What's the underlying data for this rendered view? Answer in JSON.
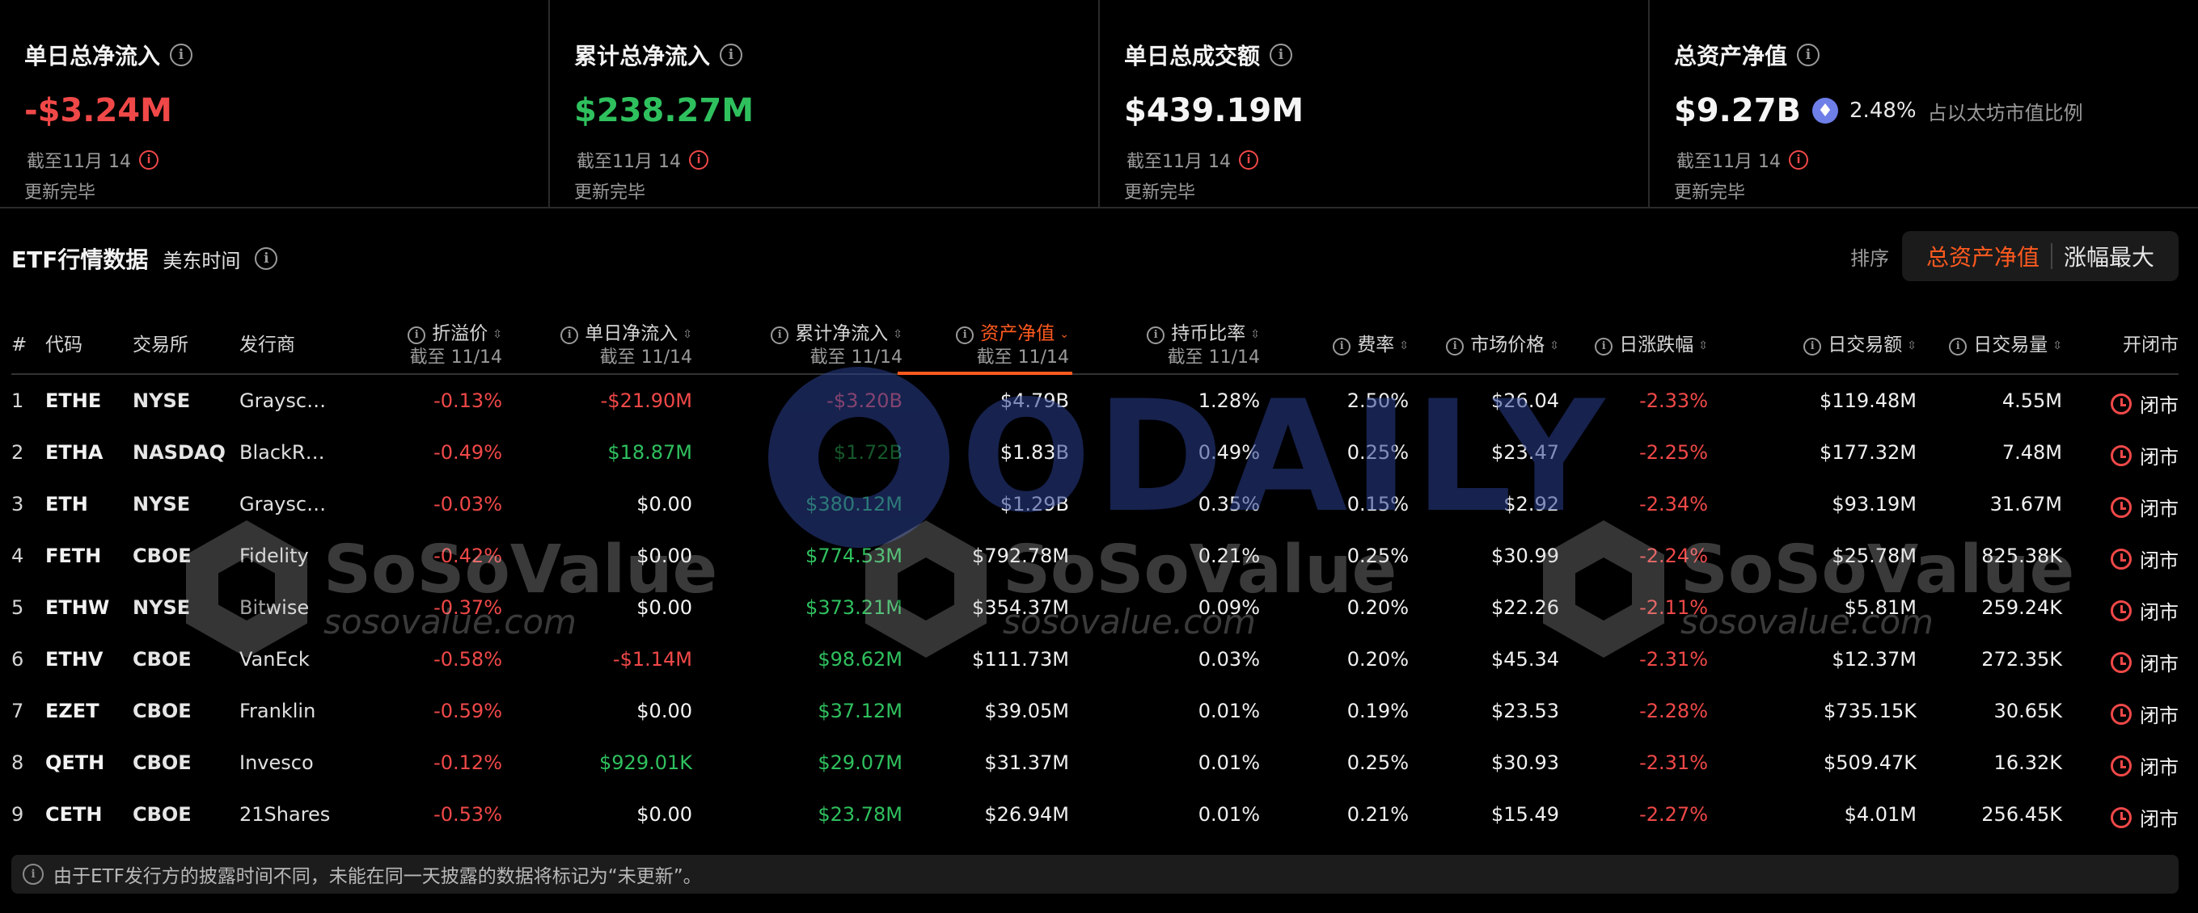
{
  "stats": [
    {
      "label": "单日总净流入",
      "value": "-$3.24M",
      "value_color": "red",
      "asof": "截至11月 14",
      "update": "更新完毕"
    },
    {
      "label": "累计总净流入",
      "value": "$238.27M",
      "value_color": "green",
      "asof": "截至11月 14",
      "update": "更新完毕"
    },
    {
      "label": "单日总成交额",
      "value": "$439.19M",
      "value_color": "white",
      "asof": "截至11月 14",
      "update": "更新完毕"
    },
    {
      "label": "总资产净值",
      "value": "$9.27B",
      "value_color": "white",
      "pct": "2.48%",
      "pct_label": "占以太坊市值比例",
      "asof": "截至11月 14",
      "update": "更新完毕"
    }
  ],
  "section": {
    "title": "ETF行情数据",
    "timezone": "美东时间",
    "sort_label": "排序",
    "sort_options": [
      "总资产净值",
      "涨幅最大"
    ]
  },
  "columns": {
    "num": "#",
    "code": "代码",
    "exchange": "交易所",
    "issuer": "发行商",
    "premium": "折溢价",
    "daily_net": "单日净流入",
    "cum_net": "累计净流入",
    "nav": "资产净值",
    "holding": "持币比率",
    "fee": "费率",
    "price": "市场价格",
    "change": "日涨跌幅",
    "volume": "日交易额",
    "qty": "日交易量",
    "openclose": "开闭市",
    "asof_sub": "截至 11/14"
  },
  "rows": [
    {
      "num": "1",
      "code": "ETHE",
      "exchange": "NYSE",
      "issuer": "Graysc…",
      "premium": "-0.13%",
      "daily_net": "-$21.90M",
      "daily_net_color": "red",
      "cum_net": "-$3.20B",
      "cum_net_color": "red",
      "nav": "$4.79B",
      "holding": "1.28%",
      "fee": "2.50%",
      "price": "$26.04",
      "change": "-2.33%",
      "volume": "$119.48M",
      "qty": "4.55M",
      "status": "闭市"
    },
    {
      "num": "2",
      "code": "ETHA",
      "exchange": "NASDAQ",
      "issuer": "BlackR…",
      "premium": "-0.49%",
      "daily_net": "$18.87M",
      "daily_net_color": "green",
      "cum_net": "$1.72B",
      "cum_net_color": "green",
      "nav": "$1.83B",
      "holding": "0.49%",
      "fee": "0.25%",
      "price": "$23.47",
      "change": "-2.25%",
      "volume": "$177.32M",
      "qty": "7.48M",
      "status": "闭市"
    },
    {
      "num": "3",
      "code": "ETH",
      "exchange": "NYSE",
      "issuer": "Graysc…",
      "premium": "-0.03%",
      "daily_net": "$0.00",
      "daily_net_color": "white",
      "cum_net": "$380.12M",
      "cum_net_color": "green",
      "nav": "$1.29B",
      "holding": "0.35%",
      "fee": "0.15%",
      "price": "$2.92",
      "change": "-2.34%",
      "volume": "$93.19M",
      "qty": "31.67M",
      "status": "闭市"
    },
    {
      "num": "4",
      "code": "FETH",
      "exchange": "CBOE",
      "issuer": "Fidelity",
      "premium": "-0.42%",
      "daily_net": "$0.00",
      "daily_net_color": "white",
      "cum_net": "$774.53M",
      "cum_net_color": "green",
      "nav": "$792.78M",
      "holding": "0.21%",
      "fee": "0.25%",
      "price": "$30.99",
      "change": "-2.24%",
      "volume": "$25.78M",
      "qty": "825.38K",
      "status": "闭市"
    },
    {
      "num": "5",
      "code": "ETHW",
      "exchange": "NYSE",
      "issuer": "Bitwise",
      "premium": "-0.37%",
      "daily_net": "$0.00",
      "daily_net_color": "white",
      "cum_net": "$373.21M",
      "cum_net_color": "green",
      "nav": "$354.37M",
      "holding": "0.09%",
      "fee": "0.20%",
      "price": "$22.26",
      "change": "-2.11%",
      "volume": "$5.81M",
      "qty": "259.24K",
      "status": "闭市"
    },
    {
      "num": "6",
      "code": "ETHV",
      "exchange": "CBOE",
      "issuer": "VanEck",
      "premium": "-0.58%",
      "daily_net": "-$1.14M",
      "daily_net_color": "red",
      "cum_net": "$98.62M",
      "cum_net_color": "green",
      "nav": "$111.73M",
      "holding": "0.03%",
      "fee": "0.20%",
      "price": "$45.34",
      "change": "-2.31%",
      "volume": "$12.37M",
      "qty": "272.35K",
      "status": "闭市"
    },
    {
      "num": "7",
      "code": "EZET",
      "exchange": "CBOE",
      "issuer": "Franklin",
      "premium": "-0.59%",
      "daily_net": "$0.00",
      "daily_net_color": "white",
      "cum_net": "$37.12M",
      "cum_net_color": "green",
      "nav": "$39.05M",
      "holding": "0.01%",
      "fee": "0.19%",
      "price": "$23.53",
      "change": "-2.28%",
      "volume": "$735.15K",
      "qty": "30.65K",
      "status": "闭市"
    },
    {
      "num": "8",
      "code": "QETH",
      "exchange": "CBOE",
      "issuer": "Invesco",
      "premium": "-0.12%",
      "daily_net": "$929.01K",
      "daily_net_color": "green",
      "cum_net": "$29.07M",
      "cum_net_color": "green",
      "nav": "$31.37M",
      "holding": "0.01%",
      "fee": "0.25%",
      "price": "$30.93",
      "change": "-2.31%",
      "volume": "$509.47K",
      "qty": "16.32K",
      "status": "闭市"
    },
    {
      "num": "9",
      "code": "CETH",
      "exchange": "CBOE",
      "issuer": "21Shares",
      "premium": "-0.53%",
      "daily_net": "$0.00",
      "daily_net_color": "white",
      "cum_net": "$23.78M",
      "cum_net_color": "green",
      "nav": "$26.94M",
      "holding": "0.01%",
      "fee": "0.21%",
      "price": "$15.49",
      "change": "-2.27%",
      "volume": "$4.01M",
      "qty": "256.45K",
      "status": "闭市"
    }
  ],
  "watermarks": {
    "odaily": "ODAILY",
    "soso_brand": "SoSoValue",
    "soso_site": "sosovalue.com"
  },
  "note": "由于ETF发行方的披露时间不同，未能在同一天披露的数据将标记为“未更新”。",
  "colors": {
    "red": "#f04848",
    "green": "#2fc05e",
    "accent": "#ff5a1f",
    "eth": "#6e7fe8"
  },
  "icons": {
    "info": "info-circle-icon",
    "warn": "alert-circle-icon",
    "clock": "clock-icon",
    "eth": "ethereum-icon",
    "sort": "sort-arrows-icon"
  }
}
